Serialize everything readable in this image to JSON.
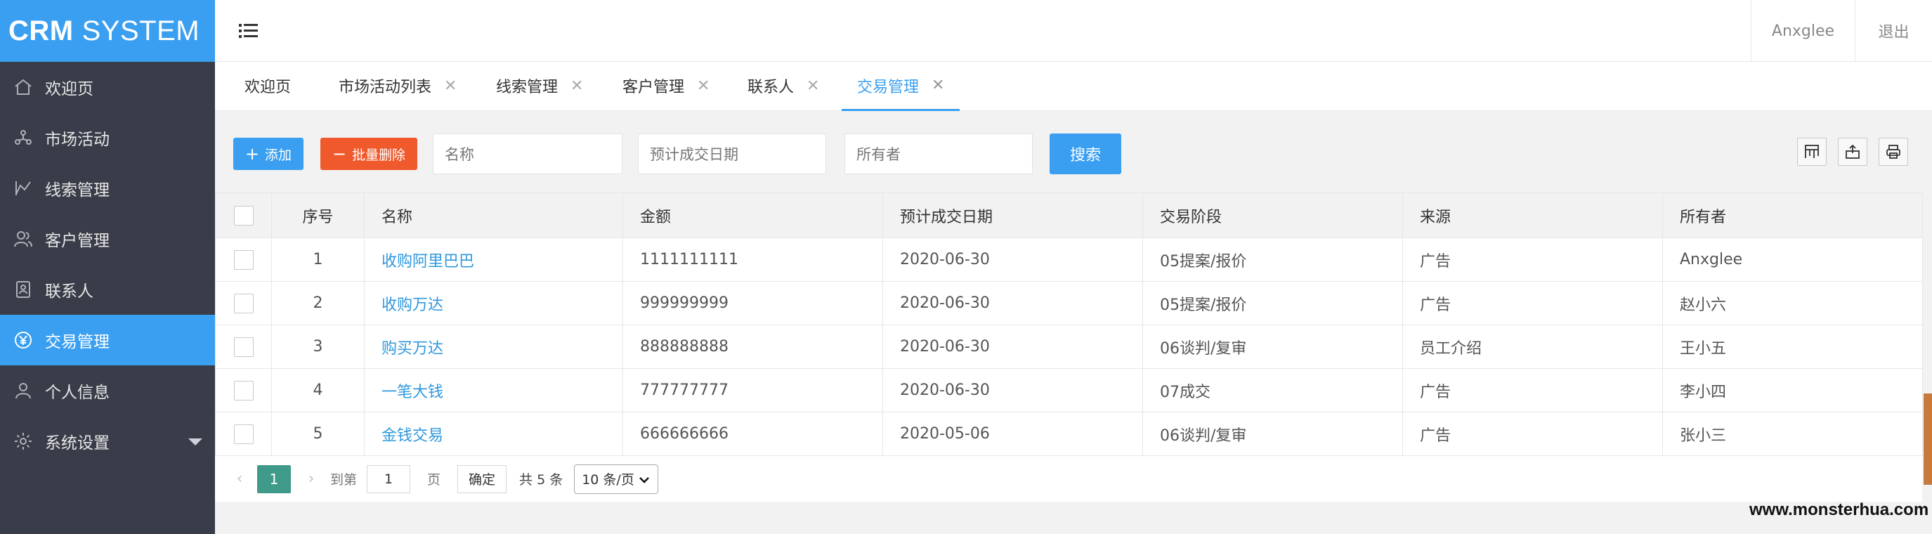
{
  "app": {
    "logo_bold": "CRM",
    "logo_text": "SYSTEM",
    "brand_color": "#3a9ff0"
  },
  "sidebar": {
    "items": [
      {
        "label": "欢迎页",
        "icon": "home-icon"
      },
      {
        "label": "市场活动",
        "icon": "people-network-icon"
      },
      {
        "label": "线索管理",
        "icon": "chart-icon"
      },
      {
        "label": "客户管理",
        "icon": "users-icon"
      },
      {
        "label": "联系人",
        "icon": "contact-card-icon"
      },
      {
        "label": "交易管理",
        "icon": "currency-icon",
        "active": true
      },
      {
        "label": "个人信息",
        "icon": "user-icon"
      },
      {
        "label": "系统设置",
        "icon": "gear-icon"
      }
    ]
  },
  "header": {
    "user_name": "Anxglee",
    "logout_label": "退出"
  },
  "tabs": [
    {
      "label": "欢迎页"
    },
    {
      "label": "市场活动列表"
    },
    {
      "label": "线索管理"
    },
    {
      "label": "客户管理"
    },
    {
      "label": "联系人"
    },
    {
      "label": "交易管理",
      "active": true
    }
  ],
  "toolbar": {
    "add_label": "添加",
    "batch_delete_label": "批量删除",
    "name_placeholder": "名称",
    "date_placeholder": "预计成交日期",
    "owner_placeholder": "所有者",
    "search_label": "搜索"
  },
  "table": {
    "columns": [
      "序号",
      "名称",
      "金额",
      "预计成交日期",
      "交易阶段",
      "来源",
      "所有者"
    ],
    "rows": [
      {
        "no": "1",
        "name": "收购阿里巴巴",
        "amount": "1111111111",
        "date": "2020-06-30",
        "stage": "05提案/报价",
        "source": "广告",
        "owner": "Anxglee"
      },
      {
        "no": "2",
        "name": "收购万达",
        "amount": "999999999",
        "date": "2020-06-30",
        "stage": "05提案/报价",
        "source": "广告",
        "owner": "赵小六"
      },
      {
        "no": "3",
        "name": "购买万达",
        "amount": "888888888",
        "date": "2020-06-30",
        "stage": "06谈判/复审",
        "source": "员工介绍",
        "owner": "王小五"
      },
      {
        "no": "4",
        "name": "一笔大钱",
        "amount": "777777777",
        "date": "2020-06-30",
        "stage": "07成交",
        "source": "广告",
        "owner": "李小四"
      },
      {
        "no": "5",
        "name": "金钱交易",
        "amount": "666666666",
        "date": "2020-05-06",
        "stage": "06谈判/复审",
        "source": "广告",
        "owner": "张小三"
      }
    ]
  },
  "pager": {
    "current_page": "1",
    "goto_label": "到第",
    "page_input": "1",
    "page_unit": "页",
    "confirm_label": "确定",
    "total_label": "共 5 条",
    "page_size": "10 条/页"
  },
  "watermark": "www.monsterhua.com"
}
